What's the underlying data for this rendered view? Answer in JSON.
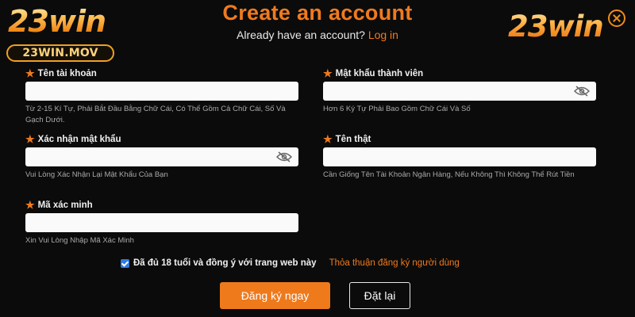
{
  "brand": {
    "logo_text": "23win",
    "badge_text": "23WIN.MOV",
    "accent": "#f07a1e"
  },
  "header": {
    "title": "Create an account",
    "subtitle_prefix": "Already have an account?",
    "login_link": "Log in"
  },
  "fields": {
    "username": {
      "label": "Tên tài khoản",
      "value": "",
      "hint": "Từ 2-15 Kí Tự, Phải Bắt Đầu Bằng Chữ Cái, Có Thể Gồm Cả Chữ Cái, Số Và Gạch Dưới."
    },
    "password": {
      "label": "Mật khẩu thành viên",
      "value": "",
      "hint": "Hơn 6 Ký Tự Phải Bao Gồm Chữ Cái Và Số"
    },
    "confirm_password": {
      "label": "Xác nhận mật khẩu",
      "value": "",
      "hint": "Vui Lòng Xác Nhận Lại Mật Khẩu Của Bạn"
    },
    "real_name": {
      "label": "Tên thật",
      "value": "",
      "hint": "Cần Giống Tên Tài Khoản Ngân Hàng, Nếu Không Thì Không Thể Rút Tiền"
    },
    "verify_code": {
      "label": "Mã xác minh",
      "value": "",
      "hint": "Xin Vui Lòng Nhập Mã Xác Minh"
    }
  },
  "agreement": {
    "checked": true,
    "text": "Đã đủ 18 tuổi và đồng ý với trang web này",
    "terms_link": "Thỏa thuận đăng ký người dùng"
  },
  "buttons": {
    "register": "Đăng ký ngay",
    "reset": "Đặt lại"
  },
  "icons": {
    "close": "close-icon",
    "password_toggle": "eye-off-icon",
    "required": "star-icon"
  }
}
